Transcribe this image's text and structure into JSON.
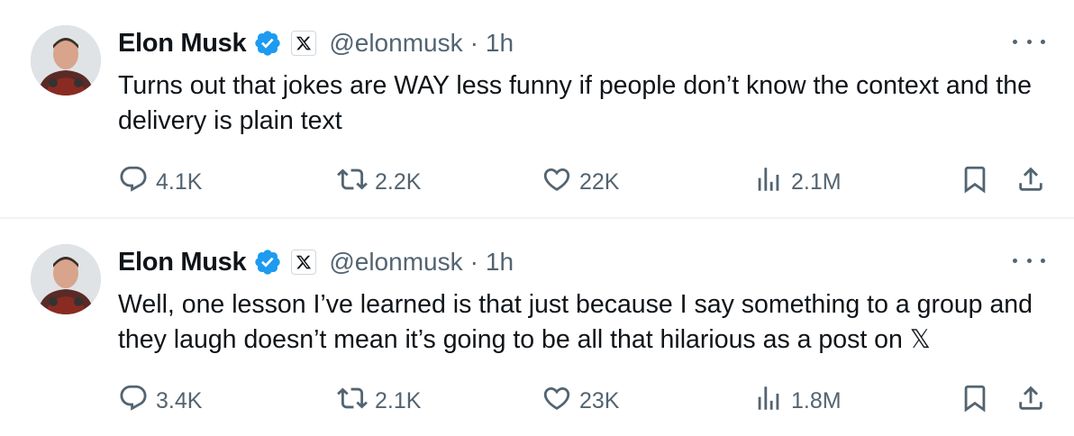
{
  "tweets": [
    {
      "author_name": "Elon Musk",
      "handle": "@elonmusk",
      "separator": "·",
      "time": "1h",
      "text": "Turns out that jokes are WAY less funny if people don’t know the context and the delivery is plain text",
      "replies": "4.1K",
      "retweets": "2.2K",
      "likes": "22K",
      "views": "2.1M"
    },
    {
      "author_name": "Elon Musk",
      "handle": "@elonmusk",
      "separator": "·",
      "time": "1h",
      "text": "Well, one lesson I’ve learned is that just because I say something to a group and they laugh doesn’t mean it’s going to be all that hilarious as a post on 𝕏",
      "replies": "3.4K",
      "retweets": "2.1K",
      "likes": "23K",
      "views": "1.8M"
    }
  ],
  "colors": {
    "text_primary": "#0f1419",
    "text_secondary": "#536471",
    "verified_blue": "#1d9bf0",
    "divider": "#eff3f4"
  },
  "icons": [
    "avatar",
    "verified-badge-icon",
    "x-affiliate-badge-icon",
    "more-icon",
    "reply-icon",
    "retweet-icon",
    "like-icon",
    "views-icon",
    "bookmark-icon",
    "share-icon"
  ]
}
